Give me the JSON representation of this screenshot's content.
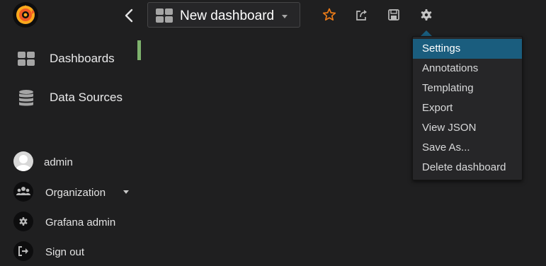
{
  "topbar": {
    "dashboard_title": "New dashboard",
    "icons": [
      "grafana-logo",
      "chevron-left-icon",
      "dashboard-grid-icon",
      "star-icon",
      "share-icon",
      "save-icon",
      "gear-icon"
    ]
  },
  "sidebar": {
    "items": [
      {
        "label": "Dashboards",
        "icon": "dashboard-grid-icon"
      },
      {
        "label": "Data Sources",
        "icon": "database-icon"
      }
    ],
    "user": {
      "name": "admin",
      "organization": "Organization",
      "admin": "Grafana admin",
      "signout": "Sign out"
    }
  },
  "settings_menu": {
    "items": [
      "Settings",
      "Annotations",
      "Templating",
      "Export",
      "View JSON",
      "Save As...",
      "Delete dashboard"
    ],
    "active": "Settings"
  },
  "colors": {
    "background": "#1f1f20",
    "menu_active": "#1a5d7e",
    "star": "#eb7b18",
    "active_marker": "#7eb26d"
  }
}
